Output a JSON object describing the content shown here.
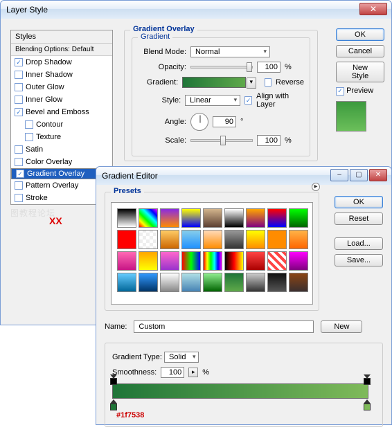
{
  "layerStyle": {
    "title": "Layer Style",
    "stylesHeader": "Styles",
    "blendingDefault": "Blending Options: Default",
    "items": [
      {
        "label": "Drop Shadow",
        "checked": true
      },
      {
        "label": "Inner Shadow",
        "checked": false
      },
      {
        "label": "Outer Glow",
        "checked": false
      },
      {
        "label": "Inner Glow",
        "checked": false
      },
      {
        "label": "Bevel and Emboss",
        "checked": true
      },
      {
        "label": "Contour",
        "checked": false,
        "indent": true
      },
      {
        "label": "Texture",
        "checked": false,
        "indent": true
      },
      {
        "label": "Satin",
        "checked": false
      },
      {
        "label": "Color Overlay",
        "checked": false
      },
      {
        "label": "Gradient Overlay",
        "checked": true,
        "selected": true
      },
      {
        "label": "Pattern Overlay",
        "checked": false
      },
      {
        "label": "Stroke",
        "checked": false
      }
    ],
    "buttons": {
      "ok": "OK",
      "cancel": "Cancel",
      "newStyle": "New Style",
      "preview": "Preview"
    },
    "gradientOverlay": {
      "groupLabel": "Gradient Overlay",
      "innerLabel": "Gradient",
      "blendModeLabel": "Blend Mode:",
      "blendMode": "Normal",
      "opacityLabel": "Opacity:",
      "opacity": "100",
      "pct": "%",
      "gradientLabel": "Gradient:",
      "reverse": "Reverse",
      "styleLabel": "Style:",
      "style": "Linear",
      "align": "Align with Layer",
      "angleLabel": "Angle:",
      "angle": "90",
      "deg": "°",
      "scaleLabel": "Scale:",
      "scale": "100"
    }
  },
  "gradientEditor": {
    "title": "Gradient Editor",
    "presetsLabel": "Presets",
    "swatches": [
      "linear-gradient(#000,#fff)",
      "linear-gradient(45deg,#f00,#ff0,#0f0,#0ff,#00f,#f0f)",
      "linear-gradient(#8a2be2,#ff8c00)",
      "linear-gradient(#ff0,#00f)",
      "linear-gradient(#d2b48c,#5c4033)",
      "linear-gradient(#fff,#000)",
      "linear-gradient(#ffa500,#800080)",
      "linear-gradient(#f00,#00f)",
      "linear-gradient(#0f0,#006400)",
      "#f00",
      "repeating-conic-gradient(#eee 0 25%,#fff 0 50%) 0/10px 10px",
      "linear-gradient(#ffcc66,#cc6600)",
      "linear-gradient(#87ceeb,#1e90ff)",
      "linear-gradient(#ffdab9,#ff8c00)",
      "linear-gradient(#999,#333)",
      "linear-gradient(#ff0,#ff8c00)",
      "#ff8c00",
      "linear-gradient(#ffb347,#ff6600)",
      "linear-gradient(#ff69b4,#c71585)",
      "linear-gradient(#ffa500,#ff0)",
      "linear-gradient(#ff66cc,#9933cc)",
      "linear-gradient(90deg,#f00,#0f0,#00f)",
      "linear-gradient(90deg,#f00,#ff0,#0f0,#0ff,#00f,#f0f)",
      "linear-gradient(90deg,#000,#f00,#ff0)",
      "linear-gradient(#ff4444,#aa0000)",
      "repeating-linear-gradient(45deg,#f44,#f44 4px,#fff 4px,#fff 8px)",
      "linear-gradient(#ff00ff,#800080)",
      "linear-gradient(#66ccff,#006699)",
      "linear-gradient(#3399ff,#003366)",
      "linear-gradient(#fff,#888)",
      "linear-gradient(#b0e0e6,#4682b4)",
      "linear-gradient(#90ee90,#006400)",
      "linear-gradient(#1f7538,#5fa94a)",
      "linear-gradient(#ccc,#333)",
      "linear-gradient(#111,#555)",
      "linear-gradient(#8b4513,#3b2f2f)"
    ],
    "nameLabel": "Name:",
    "nameValue": "Custom",
    "newBtn": "New",
    "typeLabel": "Gradient Type:",
    "typeValue": "Solid",
    "smoothLabel": "Smoothness:",
    "smoothValue": "100",
    "pct": "%",
    "hex": "#1f7538",
    "buttons": {
      "ok": "OK",
      "reset": "Reset",
      "load": "Load...",
      "save": "Save..."
    }
  },
  "redXX": "XX"
}
